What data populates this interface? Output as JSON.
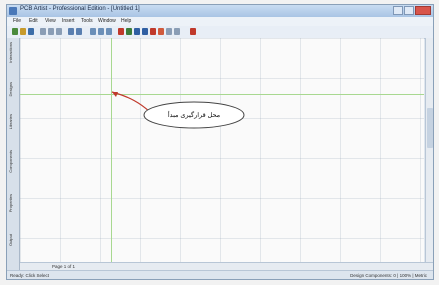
{
  "titlebar": {
    "title": "PCB Artist - Professional Edition - [Untitled 1]"
  },
  "menu": [
    "File",
    "Edit",
    "View",
    "Insert",
    "Tools",
    "Window",
    "Help"
  ],
  "left_tabs": [
    "Interactions",
    "Designs",
    "Libraries",
    "Components",
    "Properties",
    "Output"
  ],
  "sheet_tabs": {
    "label": "Page 1 of 1"
  },
  "status": {
    "left": "Ready: Click Select",
    "right": "Design Components: 0 | 100% | Metric"
  },
  "callout": {
    "text": "محل قرارگیری مبدأ"
  },
  "colors": {
    "origin_line": "#a8d890",
    "callout_arrow": "#c0392b"
  }
}
